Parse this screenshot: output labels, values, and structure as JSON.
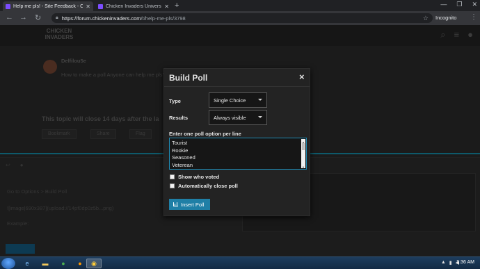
{
  "browser": {
    "tabs": [
      {
        "title": "Help me pls! - Site Feedback - Ch",
        "active": true
      },
      {
        "title": "Chicken Invaders Universe",
        "active": false
      }
    ],
    "new_tab": "+",
    "url_host": "https://forum.chickeninvaders.com",
    "url_path": "/t/help-me-pls/3798",
    "profile": "Incognito"
  },
  "forum": {
    "logo": "CHICKEN INVADERS",
    "poster": "Delfilou5e",
    "post_text": "How to make a poll Anyone can help me pls?",
    "close_notice": "This topic will close 14 days after the la",
    "actions": [
      "Bookmark",
      "Share",
      "Flag"
    ],
    "composer_lines": [
      "Go to Options > Build Poll",
      "![image|690x387](upload://14pf0dp0z5b...png)",
      "Example:"
    ]
  },
  "modal": {
    "title": "Build Poll",
    "close_icon": "×",
    "type_label": "Type",
    "type_value": "Single Choice",
    "results_label": "Results",
    "results_value": "Always visible",
    "options_label": "Enter one poll option per line",
    "options": [
      "Tourist",
      "Rookie",
      "Seasoned",
      "Veterean"
    ],
    "show_voters_label": "Show who voted",
    "auto_close_label": "Automatically close poll",
    "insert_label": "Insert Poll"
  },
  "taskbar": {
    "time": "9:36 AM"
  }
}
